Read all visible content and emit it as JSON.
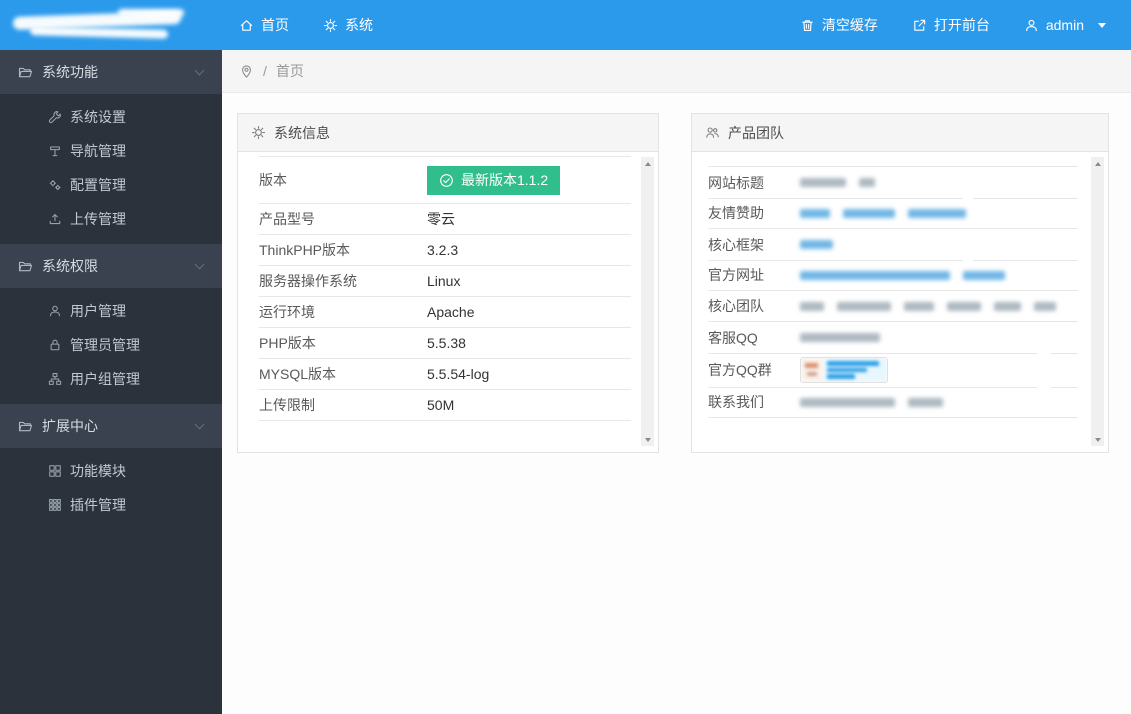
{
  "colors": {
    "topbar_blue": "#2b9aeb",
    "sidebar_dark": "#2b323c",
    "sidebar_header": "#3a4250",
    "badge_green": "#2fbe8c",
    "link_blue": "#4ea5e0"
  },
  "topbar": {
    "left": [
      {
        "label": "首页",
        "icon": "home-icon"
      },
      {
        "label": "系统",
        "icon": "gear-icon"
      }
    ],
    "right": [
      {
        "label": "清空缓存",
        "icon": "trash-icon"
      },
      {
        "label": "打开前台",
        "icon": "external-link-icon"
      },
      {
        "label": "admin",
        "icon": "user-icon",
        "has_caret": true
      }
    ]
  },
  "sidebar": {
    "sections": [
      {
        "label": "系统功能",
        "icon": "folder-icon",
        "expanded": true,
        "items": [
          {
            "label": "系统设置",
            "icon": "wrench-icon"
          },
          {
            "label": "导航管理",
            "icon": "signpost-icon"
          },
          {
            "label": "配置管理",
            "icon": "cogs-icon"
          },
          {
            "label": "上传管理",
            "icon": "upload-icon"
          }
        ]
      },
      {
        "label": "系统权限",
        "icon": "folder-icon",
        "expanded": true,
        "items": [
          {
            "label": "用户管理",
            "icon": "user-icon"
          },
          {
            "label": "管理员管理",
            "icon": "lock-icon"
          },
          {
            "label": "用户组管理",
            "icon": "group-icon"
          }
        ]
      },
      {
        "label": "扩展中心",
        "icon": "folder-icon",
        "expanded": true,
        "items": [
          {
            "label": "功能模块",
            "icon": "module-icon"
          },
          {
            "label": "插件管理",
            "icon": "plugin-icon"
          }
        ]
      }
    ]
  },
  "breadcrumb": {
    "icon": "location-pin-icon",
    "separator": "/",
    "current": "首页"
  },
  "panels": {
    "system_info": {
      "title": "系统信息",
      "icon": "gear-icon",
      "rows": [
        {
          "label": "版本",
          "value": "",
          "badge": {
            "text": "最新版本1.1.2",
            "icon": "check-circle-icon",
            "color": "#2fbe8c"
          }
        },
        {
          "label": "产品型号",
          "value": "零云"
        },
        {
          "label": "ThinkPHP版本",
          "value": "3.2.3"
        },
        {
          "label": "服务器操作系统",
          "value": "Linux"
        },
        {
          "label": "运行环境",
          "value": "Apache"
        },
        {
          "label": "PHP版本",
          "value": "5.5.38"
        },
        {
          "label": "MYSQL版本",
          "value": "5.5.54-log"
        },
        {
          "label": "上传限制",
          "value": "50M"
        }
      ]
    },
    "product_team": {
      "title": "产品团队",
      "icon": "team-icon",
      "rows": [
        {
          "label": "网站标题",
          "redacted": {
            "style": "muted",
            "widths": [
              46,
              16
            ]
          }
        },
        {
          "label": "友情赞助",
          "redacted": {
            "style": "link",
            "widths": [
              30,
              52,
              58
            ]
          }
        },
        {
          "label": "核心框架",
          "redacted": {
            "style": "link",
            "widths": [
              33
            ]
          }
        },
        {
          "label": "官方网址",
          "redacted": {
            "style": "link",
            "widths": [
              150,
              42
            ]
          }
        },
        {
          "label": "核心团队",
          "redacted": {
            "style": "muted",
            "widths": [
              24,
              54,
              30,
              34,
              27,
              22
            ]
          }
        },
        {
          "label": "客服QQ",
          "redacted": {
            "style": "muted",
            "widths": [
              80
            ]
          }
        },
        {
          "label": "官方QQ群",
          "redacted": {
            "style": "qq-badge"
          }
        },
        {
          "label": "联系我们",
          "redacted": {
            "style": "muted",
            "widths": [
              95,
              35
            ]
          }
        }
      ]
    }
  }
}
